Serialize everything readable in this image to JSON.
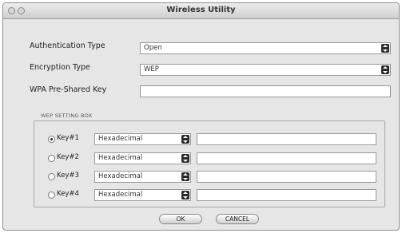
{
  "window": {
    "title": "Wireless Utility"
  },
  "form": {
    "auth_label": "Authentication Type",
    "auth_value": "Open",
    "encryption_label": "Encryption Type",
    "encryption_value": "WEP",
    "wpa_label": "WPA Pre-Shared Key",
    "wpa_value": ""
  },
  "wep": {
    "group_title": "WEP SETTING BOX",
    "keys": [
      {
        "label": "Key#1",
        "format": "Hexadecimal",
        "value": "",
        "selected": true
      },
      {
        "label": "Key#2",
        "format": "Hexadecimal",
        "value": "",
        "selected": false
      },
      {
        "label": "Key#3",
        "format": "Hexadecimal",
        "value": "",
        "selected": false
      },
      {
        "label": "Key#4",
        "format": "Hexadecimal",
        "value": "",
        "selected": false
      }
    ]
  },
  "buttons": {
    "ok": "OK",
    "cancel": "CANCEL"
  },
  "icons": {
    "select_arrow": "chevron-updown-icon"
  }
}
